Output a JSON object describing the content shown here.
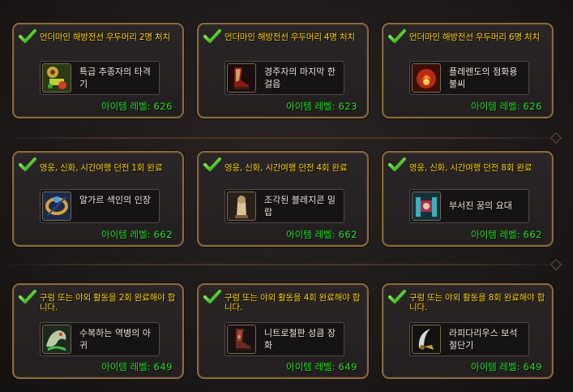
{
  "item_level_label": "아이템 레벨:",
  "colors": {
    "requirement": "#ffd200",
    "item_level": "#22e020",
    "card_border": "#8b6a3e"
  },
  "rows": [
    {
      "cards": [
        {
          "requirement": "언더마인 해방전선 우두머리 2명 처치",
          "item_name": "특급 추종자의 타격기",
          "item_level": "626",
          "icon": "trinket-icon"
        },
        {
          "requirement": "언더마인 해방전선 우두머리 4명 처치",
          "item_name": "경주자의 마지막 한 걸음",
          "item_level": "623",
          "icon": "boots-icon"
        },
        {
          "requirement": "언더마인 해방전선 우두머리 6명 처치",
          "item_name": "플레렌도의 점화용 불씨",
          "item_level": "626",
          "icon": "flame-icon"
        }
      ]
    },
    {
      "cards": [
        {
          "requirement": "영웅, 신화, 시간여행 던전 1회 완료",
          "item_name": "알가르 색인의 인장",
          "item_level": "662",
          "icon": "ring-icon"
        },
        {
          "requirement": "영웅, 신화, 시간여행 던전 4회 완료",
          "item_name": "조각된 블레지콘 밀랍",
          "item_level": "662",
          "icon": "wax-icon"
        },
        {
          "requirement": "영웅, 신화, 시간여행 던전 8회 완료",
          "item_name": "부서진 꿈의 요대",
          "item_level": "662",
          "icon": "belt-icon"
        }
      ]
    },
    {
      "cards": [
        {
          "requirement": "구렁 또는 야외 활동을 2회 완료해야 합니다.",
          "item_name": "수복하는 역병의 아귀",
          "item_level": "649",
          "icon": "dragon-icon"
        },
        {
          "requirement": "구렁 또는 야외 활동을 4회 완료해야 합니다.",
          "item_name": "니트로철판 성큼 장화",
          "item_level": "649",
          "icon": "boots-icon"
        },
        {
          "requirement": "구렁 또는 야외 활동을 8회 완료해야 합니다.",
          "item_name": "라피다리우스 보석절단기",
          "item_level": "649",
          "icon": "blade-icon"
        }
      ]
    }
  ]
}
